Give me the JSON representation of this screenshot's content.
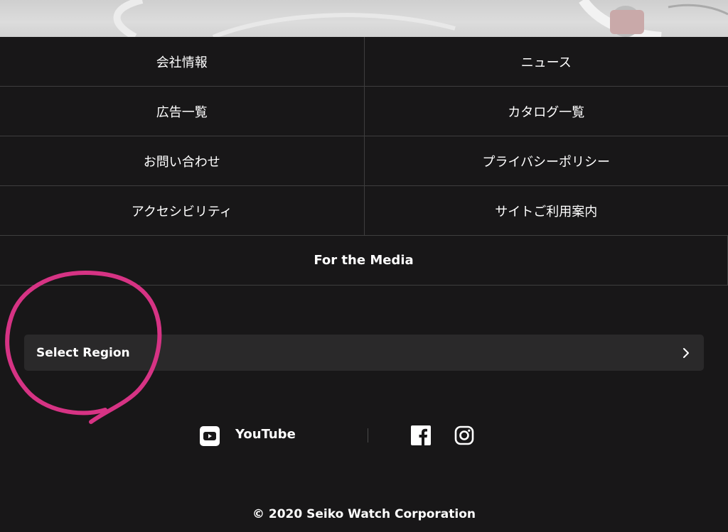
{
  "footer_links": [
    {
      "left": "会社情報",
      "right": "ニュース"
    },
    {
      "left": "広告一覧",
      "right": "カタログ一覧"
    },
    {
      "left": "お問い合わせ",
      "right": "プライバシーポリシー"
    },
    {
      "left": "アクセシビリティ",
      "right": "サイトご利用案内"
    }
  ],
  "media_link": "For the Media",
  "region": {
    "label": "Select Region"
  },
  "social": {
    "youtube_label": "YouTube",
    "icons": [
      "youtube-icon",
      "facebook-icon",
      "instagram-icon"
    ]
  },
  "copyright": "© 2020 Seiko Watch Corporation",
  "colors": {
    "background": "#181718",
    "region_bg": "#2a292a",
    "border": "#3e3e3e",
    "annotation": "#d63384"
  }
}
